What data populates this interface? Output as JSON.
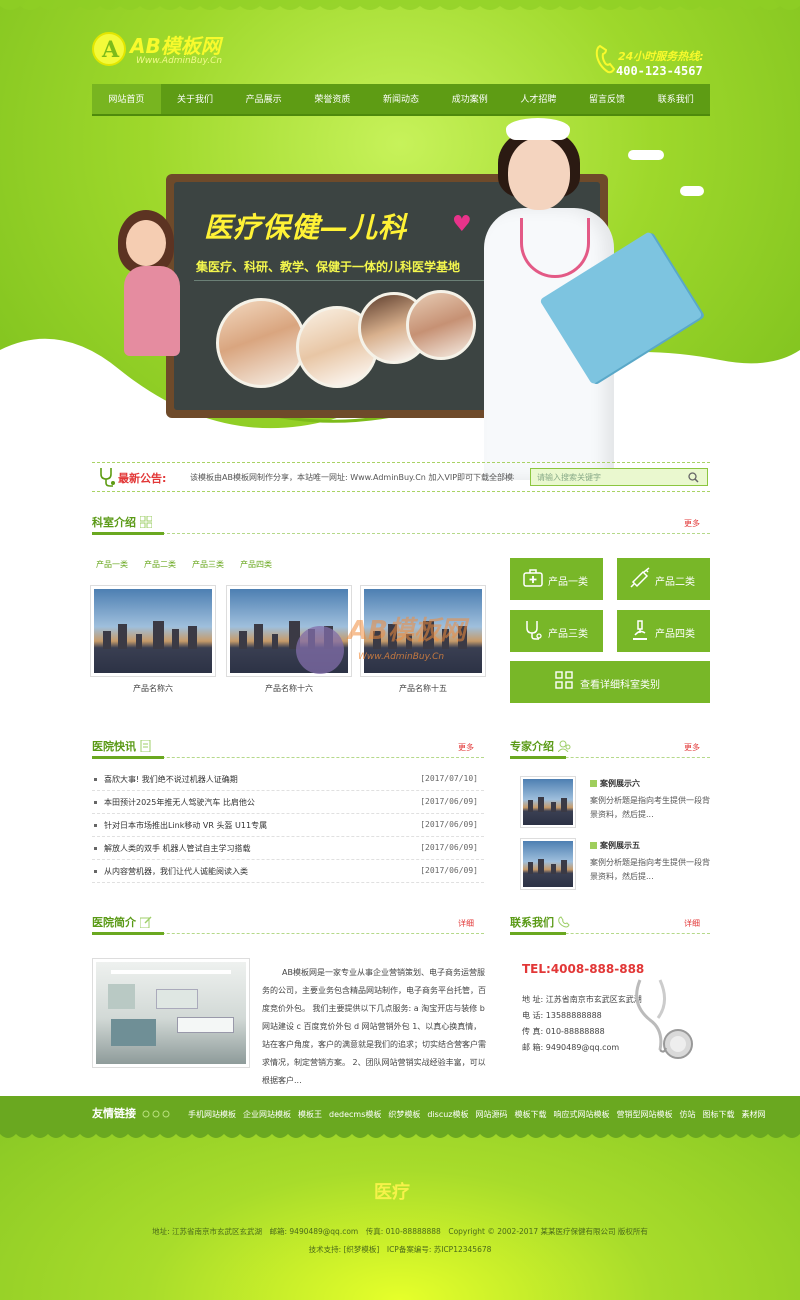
{
  "brand": {
    "logo_letter": "A",
    "name": "AB模板网",
    "url": "Www.AdminBuy.Cn"
  },
  "hotline": {
    "label": "24小时服务热线:",
    "number": "400-123-4567"
  },
  "nav": [
    "网站首页",
    "关于我们",
    "产品展示",
    "荣誉资质",
    "新闻动态",
    "成功案例",
    "人才招聘",
    "留言反馈",
    "联系我们"
  ],
  "banner": {
    "title": "医疗保健—儿科",
    "subtitle": "集医疗、科研、教学、保健于一体的儿科医学基地"
  },
  "notice": {
    "label": "最新公告:",
    "text": "该模板由AB模板网制作分享，本站唯一网址: Www.AdminBuy.Cn 加入VIP即可下载全部模板，联系",
    "search_placeholder": "请输入搜索关键字"
  },
  "departments": {
    "title": "科室介绍",
    "more": "更多",
    "tabs": [
      "产品一类",
      "产品二类",
      "产品三类",
      "产品四类"
    ],
    "products": [
      "产品名称六",
      "产品名称十六",
      "产品名称十五"
    ],
    "buttons": [
      "产品一类",
      "产品二类",
      "产品三类",
      "产品四类"
    ],
    "detail_button": "查看详细科室类别"
  },
  "watermark": {
    "text": "AB模板网",
    "url": "Www.AdminBuy.Cn"
  },
  "news": {
    "title": "医院快讯",
    "more": "更多",
    "items": [
      {
        "title": "喜欣大事! 我们绝不说过机器人证确期",
        "date": "[2017/07/10]"
      },
      {
        "title": "本田预计2025年推无人驾驶汽车 比肩他公",
        "date": "[2017/06/09]"
      },
      {
        "title": "针对日本市场推出Link移动 VR 头盔 U11专属",
        "date": "[2017/06/09]"
      },
      {
        "title": "解放人类的双手 机器人管试自主学习搭载",
        "date": "[2017/06/09]"
      },
      {
        "title": "从内容营机器，我们让代人诚能阅读入类",
        "date": "[2017/06/09]"
      }
    ]
  },
  "experts": {
    "title": "专家介绍",
    "more": "更多",
    "items": [
      {
        "name": "案例展示六",
        "desc": "案例分析题是指向考生提供一段背景资料，然后提..."
      },
      {
        "name": "案例展示五",
        "desc": "案例分析题是指向考生提供一段背景资料，然后提..."
      }
    ]
  },
  "intro": {
    "title": "医院简介",
    "more": "详细",
    "text": "AB模板网是一家专业从事企业营销策划、电子商务运营服务的公司，主要业务包含精品网站制作，电子商务平台托管，百度竞价外包。 我们主要提供以下几点服务: a 淘宝开店与装修 b 网站建设 c 百度竞价外包 d 网站营销外包 1、以真心换真情，站在客户角度，客户的满意就是我们的追求；切实结合营客户需求情况，制定营销方案。 2、团队网站营销实战经验丰富，可以根据客户..."
  },
  "contact": {
    "title": "联系我们",
    "more": "详细",
    "tel": "TEL:4008-888-888",
    "address": "地 址: 江苏省南京市玄武区玄武湖",
    "phone": "电 话: 13588888888",
    "fax": "传 真: 010-88888888",
    "email": "邮 箱: 9490489@qq.com"
  },
  "footer": {
    "links_title": "友情链接",
    "links": [
      "手机网站模板",
      "企业网站模板",
      "模板王",
      "dedecms模板",
      "织梦模板",
      "discuz模板",
      "网站源码",
      "模板下载",
      "响应式网站模板",
      "营销型网站模板",
      "仿站",
      "图标下载",
      "素材网"
    ],
    "logo": "医疗",
    "line1": "地址: 江苏省南京市玄武区玄武湖　邮箱: 9490489@qq.com　传真: 010-88888888　Copyright © 2002-2017 某某医疗保健有限公司 版权所有",
    "line2": "技术支持: [织梦模板]　ICP备案编号: 苏ICP12345678"
  },
  "colors": {
    "primary": "#78b728",
    "nav": "#5e9c14",
    "accent_red": "#e23737",
    "headline_yellow": "#f8fa2c"
  }
}
